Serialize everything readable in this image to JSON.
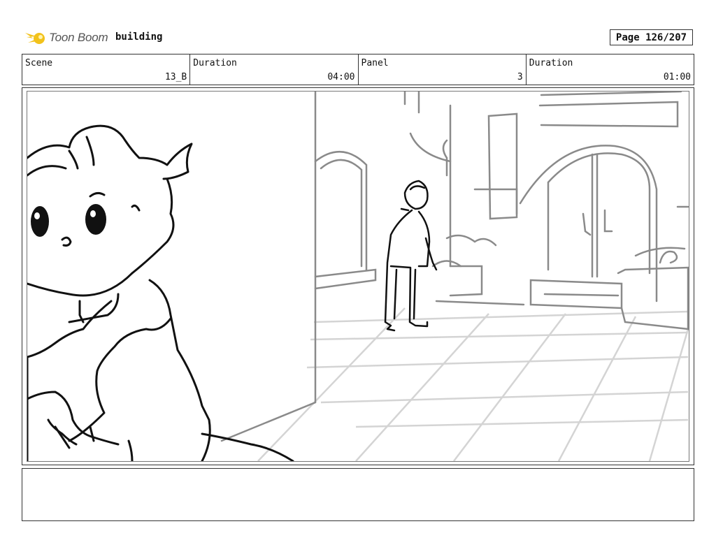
{
  "header": {
    "logo_text": "Toon Boom",
    "project_name": "building",
    "page_label": "Page 126/207"
  },
  "info": {
    "scene_label": "Scene",
    "scene_value": "13_B",
    "duration_label": "Duration",
    "duration_value": "04:00",
    "panel_label": "Panel",
    "panel_value": "3",
    "panel_duration_label": "Duration",
    "panel_duration_value": "01:00"
  },
  "panel": {
    "image": "sketch-storyboard-drawing"
  },
  "notes": {
    "text": ""
  },
  "colors": {
    "logo_yellow": "#f2c21b",
    "border": "#333333",
    "sketch_gray": "#8a8a8a"
  }
}
